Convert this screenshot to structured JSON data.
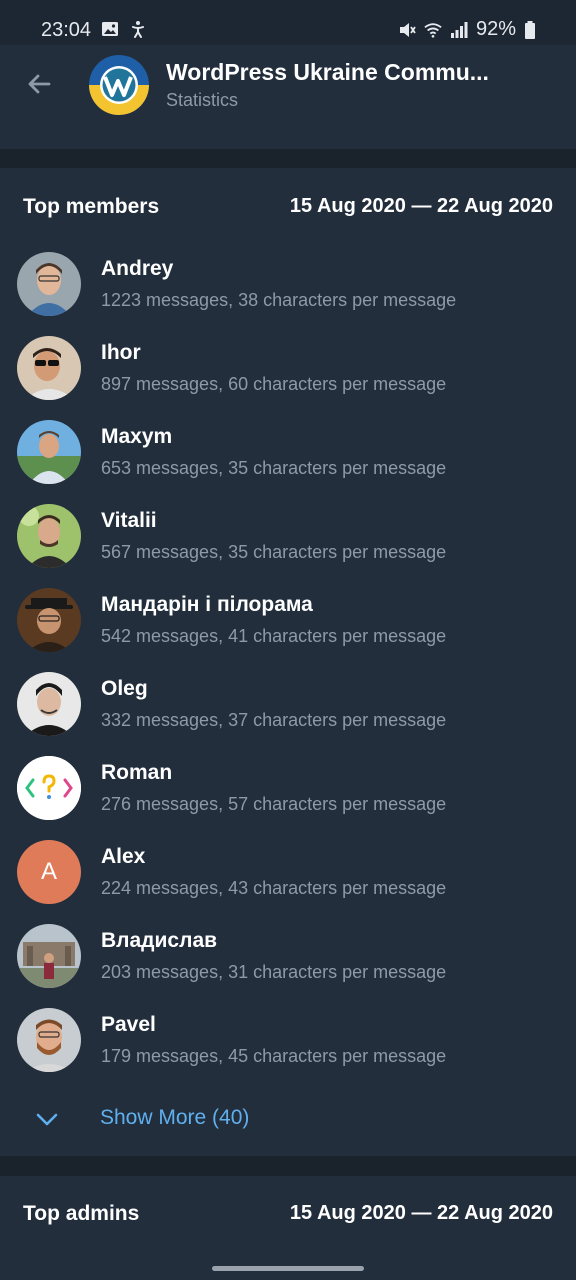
{
  "status_bar": {
    "time": "23:04",
    "battery": "92%",
    "left_icons": [
      "gallery-icon",
      "accessibility-icon"
    ],
    "right_icons": [
      "mute-icon",
      "wifi-icon",
      "signal-icon",
      "battery-icon"
    ]
  },
  "header": {
    "back_icon": "arrow-left-icon",
    "title": "WordPress Ukraine Commu...",
    "subtitle": "Statistics"
  },
  "top_members": {
    "title": "Top members",
    "range": "15 Aug 2020 — 22 Aug 2020",
    "members": [
      {
        "name": "Andrey",
        "stats": "1223 messages, 38 characters per message"
      },
      {
        "name": "Ihor",
        "stats": "897 messages, 60 characters per message"
      },
      {
        "name": "Maxym",
        "stats": "653 messages, 35 characters per message"
      },
      {
        "name": "Vitalii",
        "stats": "567 messages, 35 characters per message"
      },
      {
        "name": "Мандарін і пілорама",
        "stats": "542 messages, 41 characters per message"
      },
      {
        "name": "Oleg",
        "stats": "332 messages, 37 characters per message"
      },
      {
        "name": "Roman",
        "stats": "276 messages, 57 characters per message"
      },
      {
        "name": "Alex",
        "stats": "224 messages, 43 characters per message",
        "initial": "A",
        "avatar_color": "#e07b59"
      },
      {
        "name": "Владислав",
        "stats": "203 messages, 31 characters per message"
      },
      {
        "name": "Pavel",
        "stats": "179 messages, 45 characters per message"
      }
    ],
    "show_more": "Show More (40)"
  },
  "top_admins": {
    "title": "Top admins",
    "range": "15 Aug 2020 — 22 Aug 2020"
  },
  "colors": {
    "background": "#1d2733",
    "surface": "#232e3c",
    "accent": "#5fb0ee",
    "secondary_text": "#8d9aa8"
  }
}
